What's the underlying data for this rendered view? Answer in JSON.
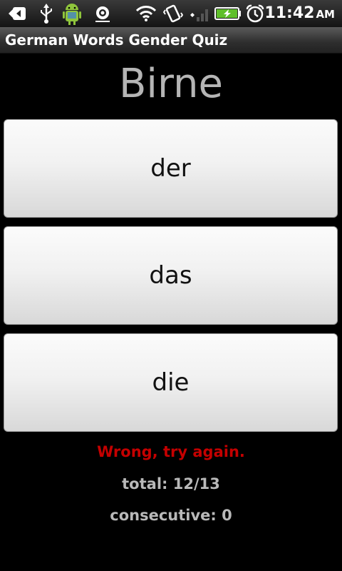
{
  "status_bar": {
    "time": "11:42",
    "ampm": "AM",
    "icons": [
      "back-arrow-icon",
      "usb-icon",
      "android-icon",
      "camera-icon",
      "wifi-icon",
      "vibrate-icon",
      "signal-icon",
      "battery-icon",
      "alarm-icon"
    ]
  },
  "app": {
    "title": "German Words Gender Quiz"
  },
  "quiz": {
    "word": "Birne",
    "options": [
      "der",
      "das",
      "die"
    ],
    "feedback": "Wrong, try again.",
    "total": "total: 12/13",
    "consecutive": "consecutive: 0"
  },
  "colors": {
    "feedback": "#c40000",
    "word": "#b5b5b5"
  }
}
